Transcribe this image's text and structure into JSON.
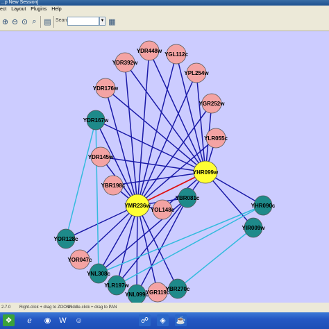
{
  "window": {
    "title": "...p New Session]"
  },
  "menu": {
    "items": [
      "ect",
      "Layout",
      "Plugins",
      "Help"
    ]
  },
  "toolbar": {
    "search_label": "Search:",
    "search_value": "",
    "icons": [
      "zoom-in-icon",
      "zoom-out-icon",
      "zoom-fit-icon",
      "zoom-selected-icon",
      "details-icon",
      "export-icon",
      "layout-icon"
    ]
  },
  "graph": {
    "background": "#ccccff",
    "colors": {
      "pink": "#f4a3a3",
      "teal": "#1e8a8a",
      "yellow": "#ffff33",
      "edge_blue": "#1a1aa8",
      "edge_cyan": "#33bbdd",
      "edge_red": "#e01010"
    },
    "nodes": [
      {
        "id": "YDR448w",
        "color": "pink"
      },
      {
        "id": "YGL112c",
        "color": "pink"
      },
      {
        "id": "YDR392w",
        "color": "pink"
      },
      {
        "id": "YPL254w",
        "color": "pink"
      },
      {
        "id": "YDR176w",
        "color": "pink"
      },
      {
        "id": "YGR252w",
        "color": "pink"
      },
      {
        "id": "YDR167w",
        "color": "teal"
      },
      {
        "id": "YLR055c",
        "color": "pink"
      },
      {
        "id": "YDR145w",
        "color": "pink"
      },
      {
        "id": "YHR099w",
        "color": "yellow"
      },
      {
        "id": "YBR198c",
        "color": "pink"
      },
      {
        "id": "YBR081c",
        "color": "teal"
      },
      {
        "id": "YMR236w",
        "color": "yellow"
      },
      {
        "id": "YOL148c",
        "color": "pink"
      },
      {
        "id": "YHR090c",
        "color": "teal"
      },
      {
        "id": "YIR009w",
        "color": "teal"
      },
      {
        "id": "YOR128c",
        "color": "teal"
      },
      {
        "id": "YOR047c",
        "color": "pink"
      },
      {
        "id": "YNL308c",
        "color": "teal"
      },
      {
        "id": "YLR197w",
        "color": "teal"
      },
      {
        "id": "YNL099c",
        "color": "teal"
      },
      {
        "id": "YGR119c",
        "color": "pink"
      },
      {
        "id": "YBR270c",
        "color": "teal"
      }
    ],
    "edges": [
      [
        "YMR236w",
        "YHR099w",
        "red"
      ],
      [
        "YMR236w",
        "YDR448w",
        "blue"
      ],
      [
        "YMR236w",
        "YGL112c",
        "blue"
      ],
      [
        "YMR236w",
        "YDR392w",
        "blue"
      ],
      [
        "YMR236w",
        "YPL254w",
        "blue"
      ],
      [
        "YMR236w",
        "YDR176w",
        "blue"
      ],
      [
        "YMR236w",
        "YGR252w",
        "blue"
      ],
      [
        "YMR236w",
        "YDR167w",
        "blue"
      ],
      [
        "YMR236w",
        "YLR055c",
        "blue"
      ],
      [
        "YMR236w",
        "YDR145w",
        "blue"
      ],
      [
        "YMR236w",
        "YBR198c",
        "blue"
      ],
      [
        "YMR236w",
        "YBR081c",
        "blue"
      ],
      [
        "YMR236w",
        "YOL148c",
        "blue"
      ],
      [
        "YMR236w",
        "YOR128c",
        "blue"
      ],
      [
        "YMR236w",
        "YOR047c",
        "blue"
      ],
      [
        "YMR236w",
        "YNL308c",
        "blue"
      ],
      [
        "YMR236w",
        "YLR197w",
        "blue"
      ],
      [
        "YMR236w",
        "YNL099c",
        "blue"
      ],
      [
        "YMR236w",
        "YGR119c",
        "blue"
      ],
      [
        "YMR236w",
        "YBR270c",
        "blue"
      ],
      [
        "YHR099w",
        "YDR448w",
        "blue"
      ],
      [
        "YHR099w",
        "YGL112c",
        "blue"
      ],
      [
        "YHR099w",
        "YDR392w",
        "blue"
      ],
      [
        "YHR099w",
        "YPL254w",
        "blue"
      ],
      [
        "YHR099w",
        "YDR176w",
        "blue"
      ],
      [
        "YHR099w",
        "YGR252w",
        "blue"
      ],
      [
        "YHR099w",
        "YDR167w",
        "blue"
      ],
      [
        "YHR099w",
        "YLR055c",
        "blue"
      ],
      [
        "YHR099w",
        "YDR145w",
        "blue"
      ],
      [
        "YHR099w",
        "YBR198c",
        "blue"
      ],
      [
        "YHR099w",
        "YBR081c",
        "blue"
      ],
      [
        "YHR099w",
        "YOL148c",
        "blue"
      ],
      [
        "YHR099w",
        "YHR090c",
        "blue"
      ],
      [
        "YHR099w",
        "YIR009w",
        "blue"
      ],
      [
        "YBR081c",
        "YNL308c",
        "blue"
      ],
      [
        "YBR081c",
        "YLR197w",
        "blue"
      ],
      [
        "YBR081c",
        "YNL099c",
        "blue"
      ],
      [
        "YDR167w",
        "YOR128c",
        "cyan"
      ],
      [
        "YHR090c",
        "YNL308c",
        "cyan"
      ],
      [
        "YHR090c",
        "YLR197w",
        "cyan"
      ],
      [
        "YIR009w",
        "YBR270c",
        "cyan"
      ],
      [
        "YDR167w",
        "YNL308c",
        "cyan"
      ]
    ]
  },
  "status": {
    "version": "2.7.0",
    "hint_zoom": "Right-click + drag to ZOOM",
    "hint_pan": "Middle-click + drag to PAN"
  },
  "taskbar": {
    "apps": [
      "start-icon",
      "ie-icon",
      "folder-icon",
      "chrome-icon",
      "word-icon",
      "photo-icon"
    ],
    "right_apps": [
      "network-icon",
      "cytoscape-icon",
      "java-icon"
    ]
  }
}
